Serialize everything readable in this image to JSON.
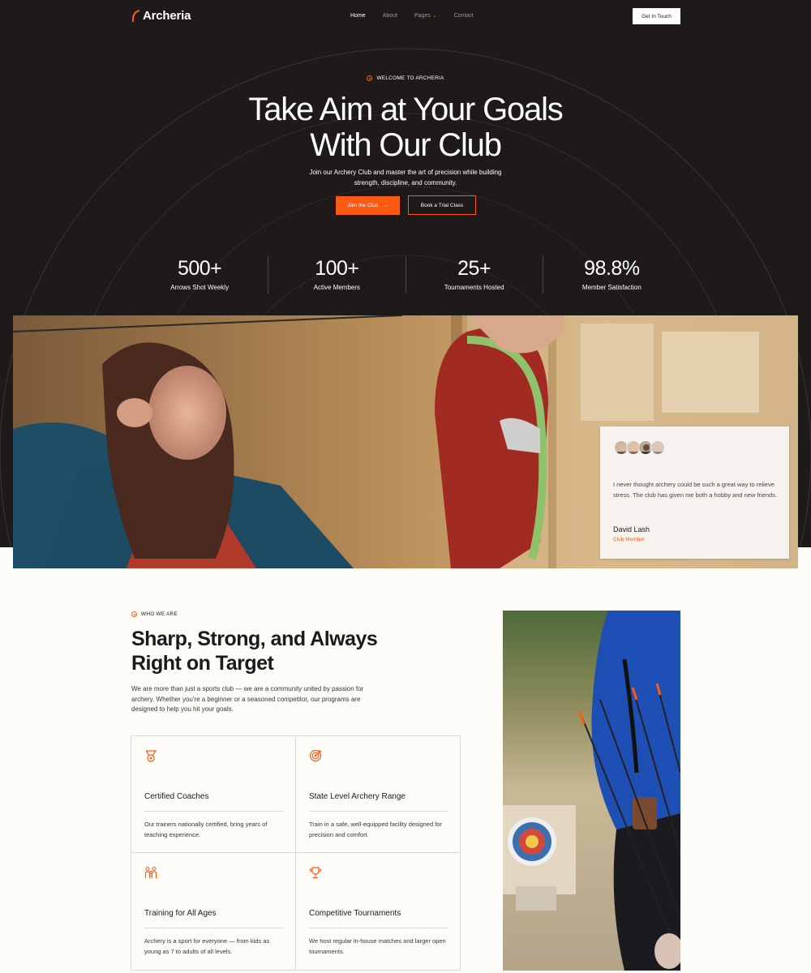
{
  "nav": {
    "logo": "Archeria",
    "links": [
      {
        "label": "Home",
        "active": true
      },
      {
        "label": "About",
        "active": false
      },
      {
        "label": "Pages",
        "active": false,
        "dropdown": true
      },
      {
        "label": "Contact",
        "active": false
      }
    ],
    "cta": "Get In Touch"
  },
  "hero": {
    "eyebrow": "WELCOME TO ARCHERIA",
    "title_line1": "Take Aim at Your Goals",
    "title_line2": "With Our Club",
    "subtitle": "Join our Archery Club and master the art of precision while building strength, discipline, and community.",
    "primary_cta": "Join the Club",
    "secondary_cta": "Book a Trial Class"
  },
  "stats": [
    {
      "value": "500+",
      "label": "Arrows Shot Weekly"
    },
    {
      "value": "100+",
      "label": "Active Members"
    },
    {
      "value": "25+",
      "label": "Tournaments Hosted"
    },
    {
      "value": "98.8%",
      "label": "Member Satisfaction"
    }
  ],
  "testimonial": {
    "quote": "I never thought archery could be such a great way to relieve stress. The club has given me both a hobby and new friends.",
    "author": "David Lash",
    "role": "Club Member"
  },
  "about": {
    "eyebrow": "WHO WE ARE",
    "title": "Sharp, Strong, and Always Right on Target",
    "body": "We are more than just a sports club — we are a community united by passion for archery. Whether you're a beginner or a seasoned competitor, our programs are designed to help you hit your goals.",
    "features": [
      {
        "icon": "medal-icon",
        "title": "Certified Coaches",
        "text": "Our trainers nationally certified, bring years of teaching experience."
      },
      {
        "icon": "target-icon",
        "title": "State Level Archery Range",
        "text": "Train in a safe, well-equipped facility designed for precision and comfort."
      },
      {
        "icon": "family-icon",
        "title": "Training for All Ages",
        "text": "Archery is a sport for everyone — from kids as young as 7 to adults of all levels."
      },
      {
        "icon": "trophy-icon",
        "title": "Competitive Tournaments",
        "text": "We host regular in-house matches and larger open tournaments."
      }
    ]
  },
  "colors": {
    "accent": "#ff5a14",
    "dark": "#1f1a1a",
    "light": "#fdfcf8"
  }
}
